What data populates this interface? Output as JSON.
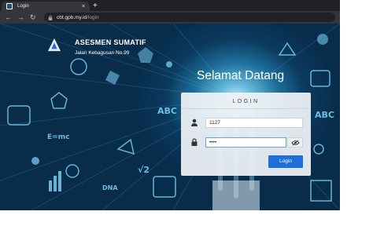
{
  "browser": {
    "tab_title": "Login",
    "tab_close": "×",
    "new_tab": "+",
    "url_host": "cbt.gpb.my.id",
    "url_path": "/login",
    "nav": {
      "back": "←",
      "forward": "→",
      "reload": "↻"
    }
  },
  "header": {
    "title": "ASESMEN SUMATIF",
    "subtitle": "Jalan Kebagusan No.99"
  },
  "welcome": "Selamat Datang",
  "login": {
    "heading": "LOGIN",
    "username_value": "1127",
    "password_value": "••••",
    "submit_label": "Login"
  },
  "decorations": {
    "abc": "ABC",
    "emc": "E=mc",
    "sqrt": "√2",
    "dna": "DNA"
  },
  "colors": {
    "accent": "#1e6fd9",
    "background": "#0b3a5f",
    "doodle": "#7fd6f7"
  },
  "icons": [
    "user-icon",
    "lock-icon",
    "eye-slash-icon",
    "school-logo-icon"
  ]
}
